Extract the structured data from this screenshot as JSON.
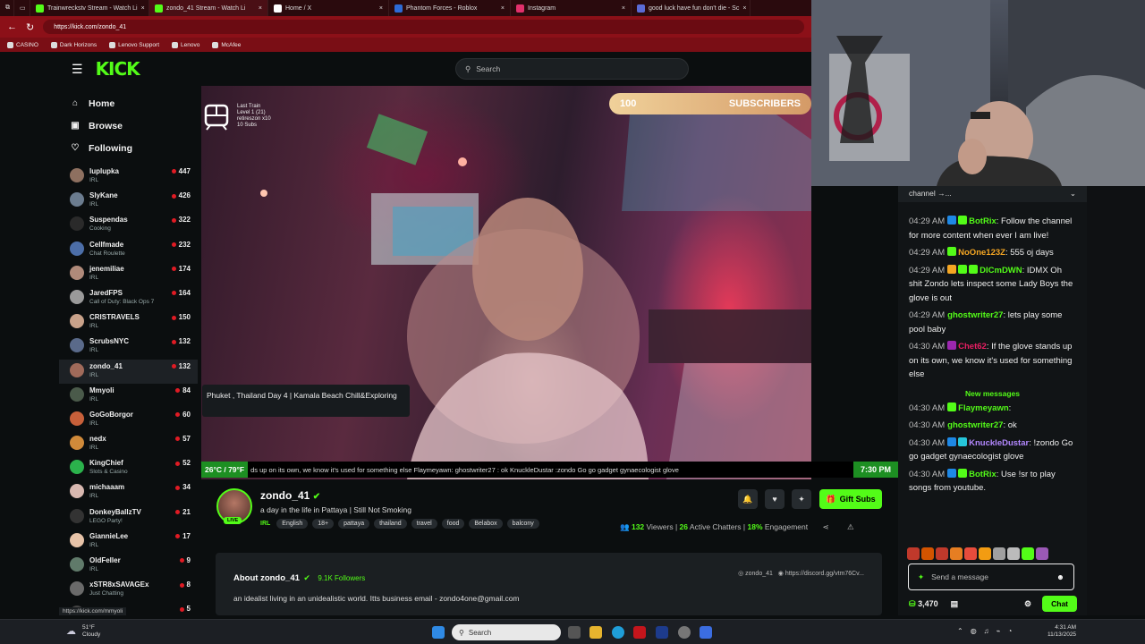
{
  "browser": {
    "tabs": [
      {
        "label": "Trainwreckstv Stream - Watch Li",
        "color": "#53fc18"
      },
      {
        "label": "zondo_41 Stream - Watch Li",
        "color": "#53fc18"
      },
      {
        "label": "Home / X",
        "color": "#ffffff"
      },
      {
        "label": "Phantom Forces - Roblox",
        "color": "#2d6bd6"
      },
      {
        "label": "Instagram",
        "color": "#e1306c"
      },
      {
        "label": "good luck have fun don't die - Sc",
        "color": "#5b6bd6"
      }
    ],
    "url": "https://kick.com/zondo_41",
    "bookmarks": [
      "CASINO",
      "Dark Horizons",
      "Lenovo Support",
      "Lenovo",
      "McAfee"
    ]
  },
  "kick": {
    "logo": "KICK",
    "search_placeholder": "Search",
    "nav": [
      {
        "label": "Home",
        "icon": "⌂"
      },
      {
        "label": "Browse",
        "icon": "▣"
      },
      {
        "label": "Following",
        "icon": "♡"
      }
    ],
    "channels": [
      {
        "name": "luplupka",
        "cat": "IRL",
        "viewers": "447",
        "color": "#8e7060"
      },
      {
        "name": "SlyKane",
        "cat": "IRL",
        "viewers": "426",
        "color": "#6b7c8f"
      },
      {
        "name": "Suspendas",
        "cat": "Cooking",
        "viewers": "322",
        "color": "#2a2a2a"
      },
      {
        "name": "Cellfmade",
        "cat": "Chat Roulette",
        "viewers": "232",
        "color": "#4c6ea8"
      },
      {
        "name": "jenemiliae",
        "cat": "IRL",
        "viewers": "174",
        "color": "#b08a7a"
      },
      {
        "name": "JaredFPS",
        "cat": "Call of Duty: Black Ops 7",
        "viewers": "164",
        "color": "#9a9a9a"
      },
      {
        "name": "CRISTRAVELS",
        "cat": "IRL",
        "viewers": "150",
        "color": "#c9a28a"
      },
      {
        "name": "ScrubsNYC",
        "cat": "IRL",
        "viewers": "132",
        "color": "#5a6a8a"
      },
      {
        "name": "zondo_41",
        "cat": "IRL",
        "viewers": "132",
        "color": "#a06a5a"
      },
      {
        "name": "Mmyoli",
        "cat": "IRL",
        "viewers": "84",
        "color": "#4a5a4a"
      },
      {
        "name": "GoGoBorgor",
        "cat": "IRL",
        "viewers": "60",
        "color": "#c7603a"
      },
      {
        "name": "nedx",
        "cat": "IRL",
        "viewers": "57",
        "color": "#d08a3a"
      },
      {
        "name": "KingChief",
        "cat": "Slots & Casino",
        "viewers": "52",
        "color": "#2bb24c"
      },
      {
        "name": "michaaam",
        "cat": "IRL",
        "viewers": "34",
        "color": "#d8b8b0"
      },
      {
        "name": "DonkeyBallzTV",
        "cat": "LEGO Party!",
        "viewers": "21",
        "color": "#333333"
      },
      {
        "name": "GiannieLee",
        "cat": "IRL",
        "viewers": "17",
        "color": "#e7c3a8"
      },
      {
        "name": "OldFeller",
        "cat": "IRL",
        "viewers": "9",
        "color": "#607a6a"
      },
      {
        "name": "xSTR8xSAVAGEx",
        "cat": "Just Chatting",
        "viewers": "8",
        "color": "#6a6a6a"
      },
      {
        "name": "",
        "cat": "",
        "viewers": "5",
        "color": "#444444"
      }
    ],
    "video": {
      "overlay_text": [
        "Last Train",
        "Level 1 (21)",
        "retireszon x10",
        "10 Subs"
      ],
      "sub_goal_count": "100",
      "sub_goal_label": "SUBSCRIBERS",
      "temp": "26°C / 79°F",
      "ticker": "ds up on its own, we know it's used for something else  Flaymeyawn:  ghostwriter27 : ok  KnuckleDustar :zondo Go go gadget gynaecologist glove",
      "time": "7:30 PM"
    },
    "tooltip": "Phuket , Thailand Day 4 | Kamala Beach Chill&Exploring",
    "streamer": {
      "name": "zondo_41",
      "live": "LIVE",
      "title": "a day in the life in Pattaya | Still Not Smoking",
      "category": "IRL",
      "tags": [
        "English",
        "18+",
        "pattaya",
        "thailand",
        "travel",
        "food",
        "Belabox",
        "balcony"
      ],
      "viewers": "132",
      "viewers_label": "Viewers",
      "chatters": "26",
      "chatters_label": "Active Chatters",
      "engagement": "18%",
      "engagement_label": "Engagement",
      "gift_label": "Gift Subs"
    },
    "about": {
      "title": "About zondo_41",
      "followers": "9.1K Followers",
      "bio": "an idealist living in an unidealistic world. Itts business email - zondo4one@gmail.com",
      "link1": "zondo_41",
      "link2": "https://discord.gg/vtm76Cv..."
    },
    "chat": {
      "pinned": "channel →...",
      "messages": [
        {
          "time": "04:29 AM",
          "user": "BotRix",
          "ucolor": "#53fc18",
          "text": ": Follow the channel for more content when ever I am live!",
          "badges": [
            "#1e88e5",
            "#53fc18"
          ]
        },
        {
          "time": "04:29 AM",
          "user": "NoOne123Z",
          "ucolor": "#f5a623",
          "text": ": 555 oj days",
          "badges": [
            "#53fc18"
          ]
        },
        {
          "time": "04:29 AM",
          "user": "DICmDWN",
          "ucolor": "#53fc18",
          "text": ": IDMX Oh shit Zondo lets inspect some Lady Boys the glove is out",
          "badges": [
            "#f5a623",
            "#53fc18",
            "#53fc18"
          ]
        },
        {
          "time": "04:29 AM",
          "user": "ghostwriter27",
          "ucolor": "#53fc18",
          "text": ": lets play some pool baby",
          "badges": []
        },
        {
          "time": "04:30 AM",
          "user": "Chet62",
          "ucolor": "#e91e63",
          "text": ": If the glove stands up on its own, we know it's used for something else",
          "badges": [
            "#9c27b0"
          ]
        }
      ],
      "new_messages": "New messages",
      "messages2": [
        {
          "time": "04:30 AM",
          "user": "Flaymeyawn",
          "ucolor": "#53fc18",
          "text": ":",
          "badges": [
            "#53fc18"
          ]
        },
        {
          "time": "04:30 AM",
          "user": "ghostwriter27",
          "ucolor": "#53fc18",
          "text": ": ok",
          "badges": []
        },
        {
          "time": "04:30 AM",
          "user": "KnuckleDustar",
          "ucolor": "#b388ff",
          "text": ": !zondo Go go gadget gynaecologist glove",
          "badges": [
            "#1e88e5",
            "#26c6da"
          ]
        },
        {
          "time": "04:30 AM",
          "user": "BotRix",
          "ucolor": "#53fc18",
          "text": ": Use !sr to play songs from youtube.",
          "badges": [
            "#1e88e5",
            "#53fc18"
          ]
        }
      ],
      "input_placeholder": "Send a message",
      "points": "3,470",
      "chat_btn": "Chat"
    },
    "status_url": "https://kick.com/mmyoli"
  },
  "taskbar": {
    "weather_temp": "51°F",
    "weather_desc": "Cloudy",
    "search": "Search",
    "time": "4:31 AM",
    "date": "11/13/2025"
  }
}
